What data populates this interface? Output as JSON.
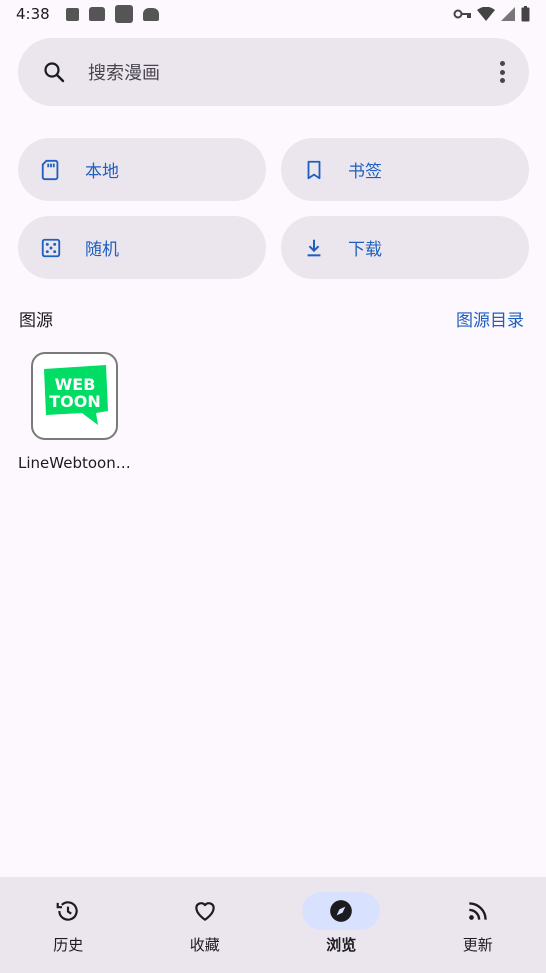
{
  "status_bar": {
    "time": "4:38"
  },
  "search": {
    "placeholder": "搜索漫画"
  },
  "quick_actions": {
    "local": "本地",
    "bookmarks": "书签",
    "random": "随机",
    "download": "下载"
  },
  "sources": {
    "title": "图源",
    "catalog_link": "图源目录",
    "items": [
      {
        "name": "LineWebtoon…",
        "logo_text_top": "WEB",
        "logo_text_bottom": "TOON"
      }
    ]
  },
  "bottom_nav": {
    "items": [
      {
        "label": "历史",
        "icon": "history-icon"
      },
      {
        "label": "收藏",
        "icon": "heart-icon"
      },
      {
        "label": "浏览",
        "icon": "compass-icon",
        "active": true
      },
      {
        "label": "更新",
        "icon": "rss-icon"
      }
    ]
  },
  "colors": {
    "background": "#fdf7fe",
    "surface": "#ebe6ee",
    "accent": "#1f5fbf",
    "active_indicator": "#d8e2ff",
    "webtoon_green": "#00dc64"
  }
}
